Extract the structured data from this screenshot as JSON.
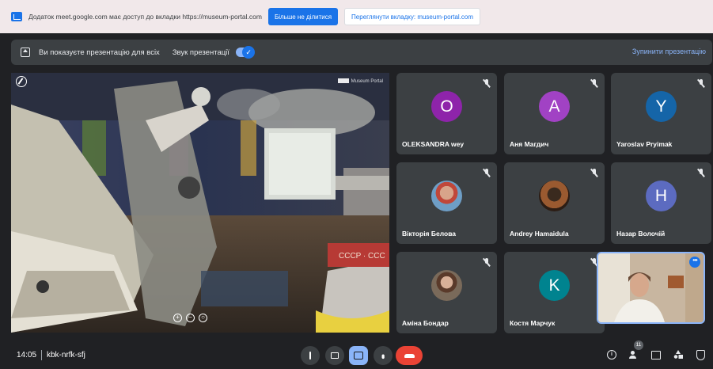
{
  "share_notice": {
    "message": "Додаток meet.google.com має доступ до вкладки https://museum-portal.com",
    "stop_sharing_label": "Більше не ділитися",
    "view_tab_label": "Переглянути вкладку: museum-portal.com",
    "icon": "share-tab-icon"
  },
  "presenting_banner": {
    "text": "Ви показуєте презентацію для всіх",
    "sound_label": "Звук презентації",
    "sound_enabled": true,
    "toggle_check": "✓",
    "stop_label": "Зупинити презентацію"
  },
  "presentation": {
    "watermark": "Museum Portal",
    "controls": [
      "+",
      "−",
      "○"
    ],
    "banner_text": "CCCP · CCC"
  },
  "participants": [
    {
      "name": "OLEKSANDRA wey",
      "initial": "O",
      "avatar_color": "#8e24aa",
      "muted": true
    },
    {
      "name": "Аня Магдич",
      "initial": "A",
      "avatar_color": "#a142c4",
      "muted": true
    },
    {
      "name": "Yaroslav Pryimak",
      "initial": "Y",
      "avatar_color": "#1565a8",
      "muted": true
    },
    {
      "name": "Вікторія Белова",
      "photo": true,
      "muted": true
    },
    {
      "name": "Andrey Hamaidula",
      "photo": true,
      "muted": true
    },
    {
      "name": "Назар Волочій",
      "initial": "H",
      "avatar_color": "#5c6bc0",
      "muted": true
    },
    {
      "name": "Аміна Бондар",
      "photo": true,
      "muted": true
    },
    {
      "name": "Костя Марчук",
      "initial": "K",
      "avatar_color": "#00838f",
      "muted": true
    }
  ],
  "self_view": {
    "menu_label": "•••"
  },
  "bottom_bar": {
    "time": "14:05",
    "meeting_code": "kbk-nrfk-sfj",
    "participant_count": "11",
    "info_glyph": "i",
    "accent": "#8ab4f8",
    "leave_color": "#ea4335"
  }
}
